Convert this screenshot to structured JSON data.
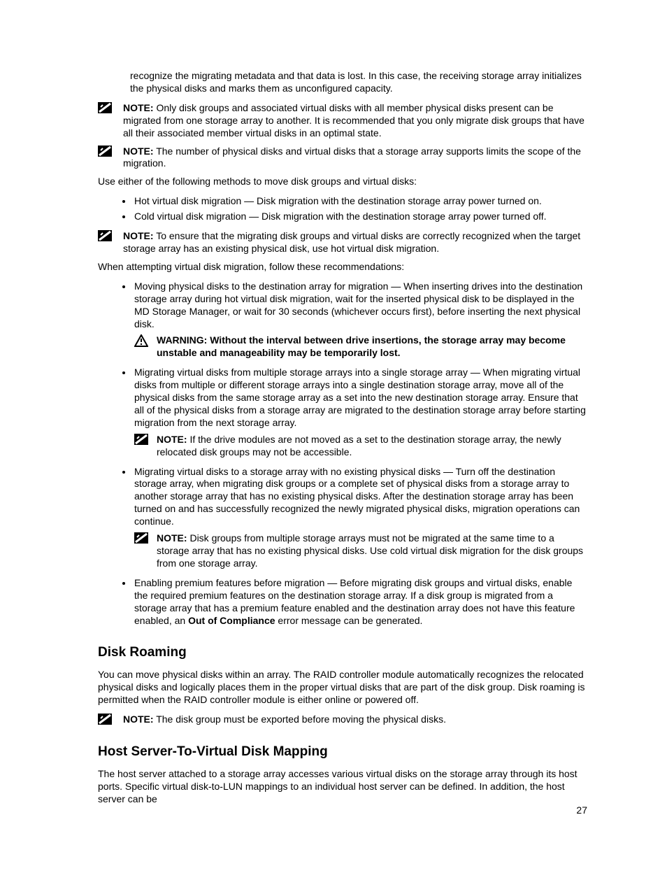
{
  "paragraphs": {
    "top_continuation": "recognize the migrating metadata and that data is lost. In this case, the receiving storage array initializes the physical disks and marks them as unconfigured capacity.",
    "note1_label": "NOTE:",
    "note1_body": " Only disk groups and associated virtual disks with all member physical disks present can be migrated from one storage array to another. It is recommended that you only migrate disk groups that have all their associated member virtual disks in an optimal state.",
    "note2_label": "NOTE:",
    "note2_body": " The number of physical disks and virtual disks that a storage array supports limits the scope of the migration.",
    "use_either": "Use either of the following methods to move disk groups and virtual disks:",
    "bullets_methods": {
      "hot": "Hot virtual disk migration — Disk migration with the destination storage array power turned on.",
      "cold": "Cold virtual disk migration — Disk migration with the destination storage array power turned off."
    },
    "note3_label": "NOTE:",
    "note3_body": " To ensure that the migrating disk groups and virtual disks are correctly recognized when the target storage array has an existing physical disk, use hot virtual disk migration.",
    "attempting_intro": "When attempting virtual disk migration, follow these recommendations:",
    "rec1": "Moving physical disks to the destination array for migration — When inserting drives into the destination storage array during hot virtual disk migration, wait for the inserted physical disk to be displayed in the MD Storage Manager, or wait for 30 seconds (whichever occurs first), before inserting the next physical disk.",
    "warn_label": "WARNING: ",
    "warn_body": "Without the interval between drive insertions, the storage array may become unstable and manageability may be temporarily lost.",
    "rec2": "Migrating virtual disks from multiple storage arrays into a single storage array — When migrating virtual disks from multiple or different storage arrays into a single destination storage array, move all of the physical disks from the same storage array as a set into the new destination storage array. Ensure that all of the physical disks from a storage array are migrated to the destination storage array before starting migration from the next storage array.",
    "rec2_note_label": "NOTE:",
    "rec2_note_body": " If the drive modules are not moved as a set to the destination storage array, the newly relocated disk groups may not be accessible.",
    "rec3": "Migrating virtual disks to a storage array with no existing physical disks — Turn off the destination storage array, when migrating disk groups or a complete set of physical disks from a storage array to another storage array that has no existing physical disks. After the destination storage array has been turned on and has successfully recognized the newly migrated physical disks, migration operations can continue.",
    "rec3_note_label": "NOTE:",
    "rec3_note_body": " Disk groups from multiple storage arrays must not be migrated at the same time to a storage array that has no existing physical disks. Use cold virtual disk migration for the disk groups from one storage array.",
    "rec4_pre": "Enabling premium features before migration — Before migrating disk groups and virtual disks, enable the required premium features on the destination storage array. If a disk group is migrated from a storage array that has a premium feature enabled and the destination array does not have this feature enabled, an ",
    "rec4_bold": "Out of Compliance",
    "rec4_post": " error message can be generated."
  },
  "diskRoaming": {
    "heading": "Disk Roaming",
    "body": "You can move physical disks within an array. The RAID controller module automatically recognizes the relocated physical disks and logically places them in the proper virtual disks that are part of the disk group. Disk roaming is permitted when the RAID controller module is either online or powered off.",
    "note_label": "NOTE:",
    "note_body": " The disk group must be exported before moving the physical disks."
  },
  "hostMapping": {
    "heading": "Host Server-To-Virtual Disk Mapping",
    "body": "The host server attached to a storage array accesses various virtual disks on the storage array through its host ports. Specific virtual disk-to-LUN mappings to an individual host server can be defined. In addition, the host server can be"
  },
  "pageNumber": "27"
}
